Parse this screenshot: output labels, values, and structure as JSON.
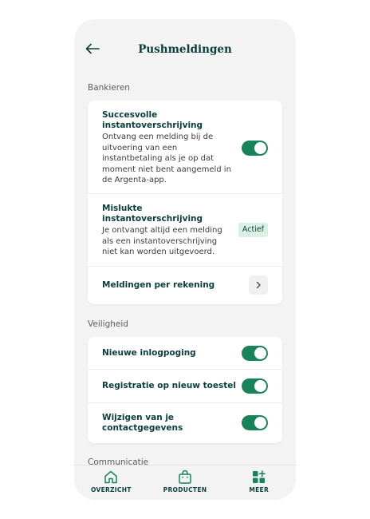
{
  "header": {
    "title": "Pushmeldingen"
  },
  "sections": {
    "banking": {
      "label": "Bankieren",
      "success": {
        "title": "Succesvolle instantoverschrijving",
        "description": "Ontvang een melding bij de uitvoering van een instantbetaling als je op dat moment niet bent aangemeld in de Argenta-app.",
        "toggle": "on"
      },
      "failed": {
        "title": "Mislukte instantoverschrijving",
        "description": "Je ontvangt altijd een melding als een instantoverschrijving niet kan worden uitgevoerd.",
        "badge": "Actief"
      },
      "per_account": {
        "title": "Meldingen per rekening"
      }
    },
    "security": {
      "label": "Veiligheid",
      "items": [
        {
          "title": "Nieuwe inlogpoging",
          "toggle": "on"
        },
        {
          "title": "Registratie op nieuw toestel",
          "toggle": "on"
        },
        {
          "title": "Wijzigen van je contactgegevens",
          "toggle": "on"
        }
      ]
    },
    "communication": {
      "label": "Communicatie"
    }
  },
  "tabbar": {
    "items": [
      {
        "label": "OVERZICHT",
        "icon": "home-icon"
      },
      {
        "label": "PRODUCTEN",
        "icon": "shopping-bag-icon"
      },
      {
        "label": "MEER",
        "icon": "grid-plus-icon"
      }
    ]
  },
  "colors": {
    "accent": "#17845b",
    "title": "#0b3d3d",
    "badge_bg": "#d9f0e3",
    "background": "#f3f3f3"
  }
}
